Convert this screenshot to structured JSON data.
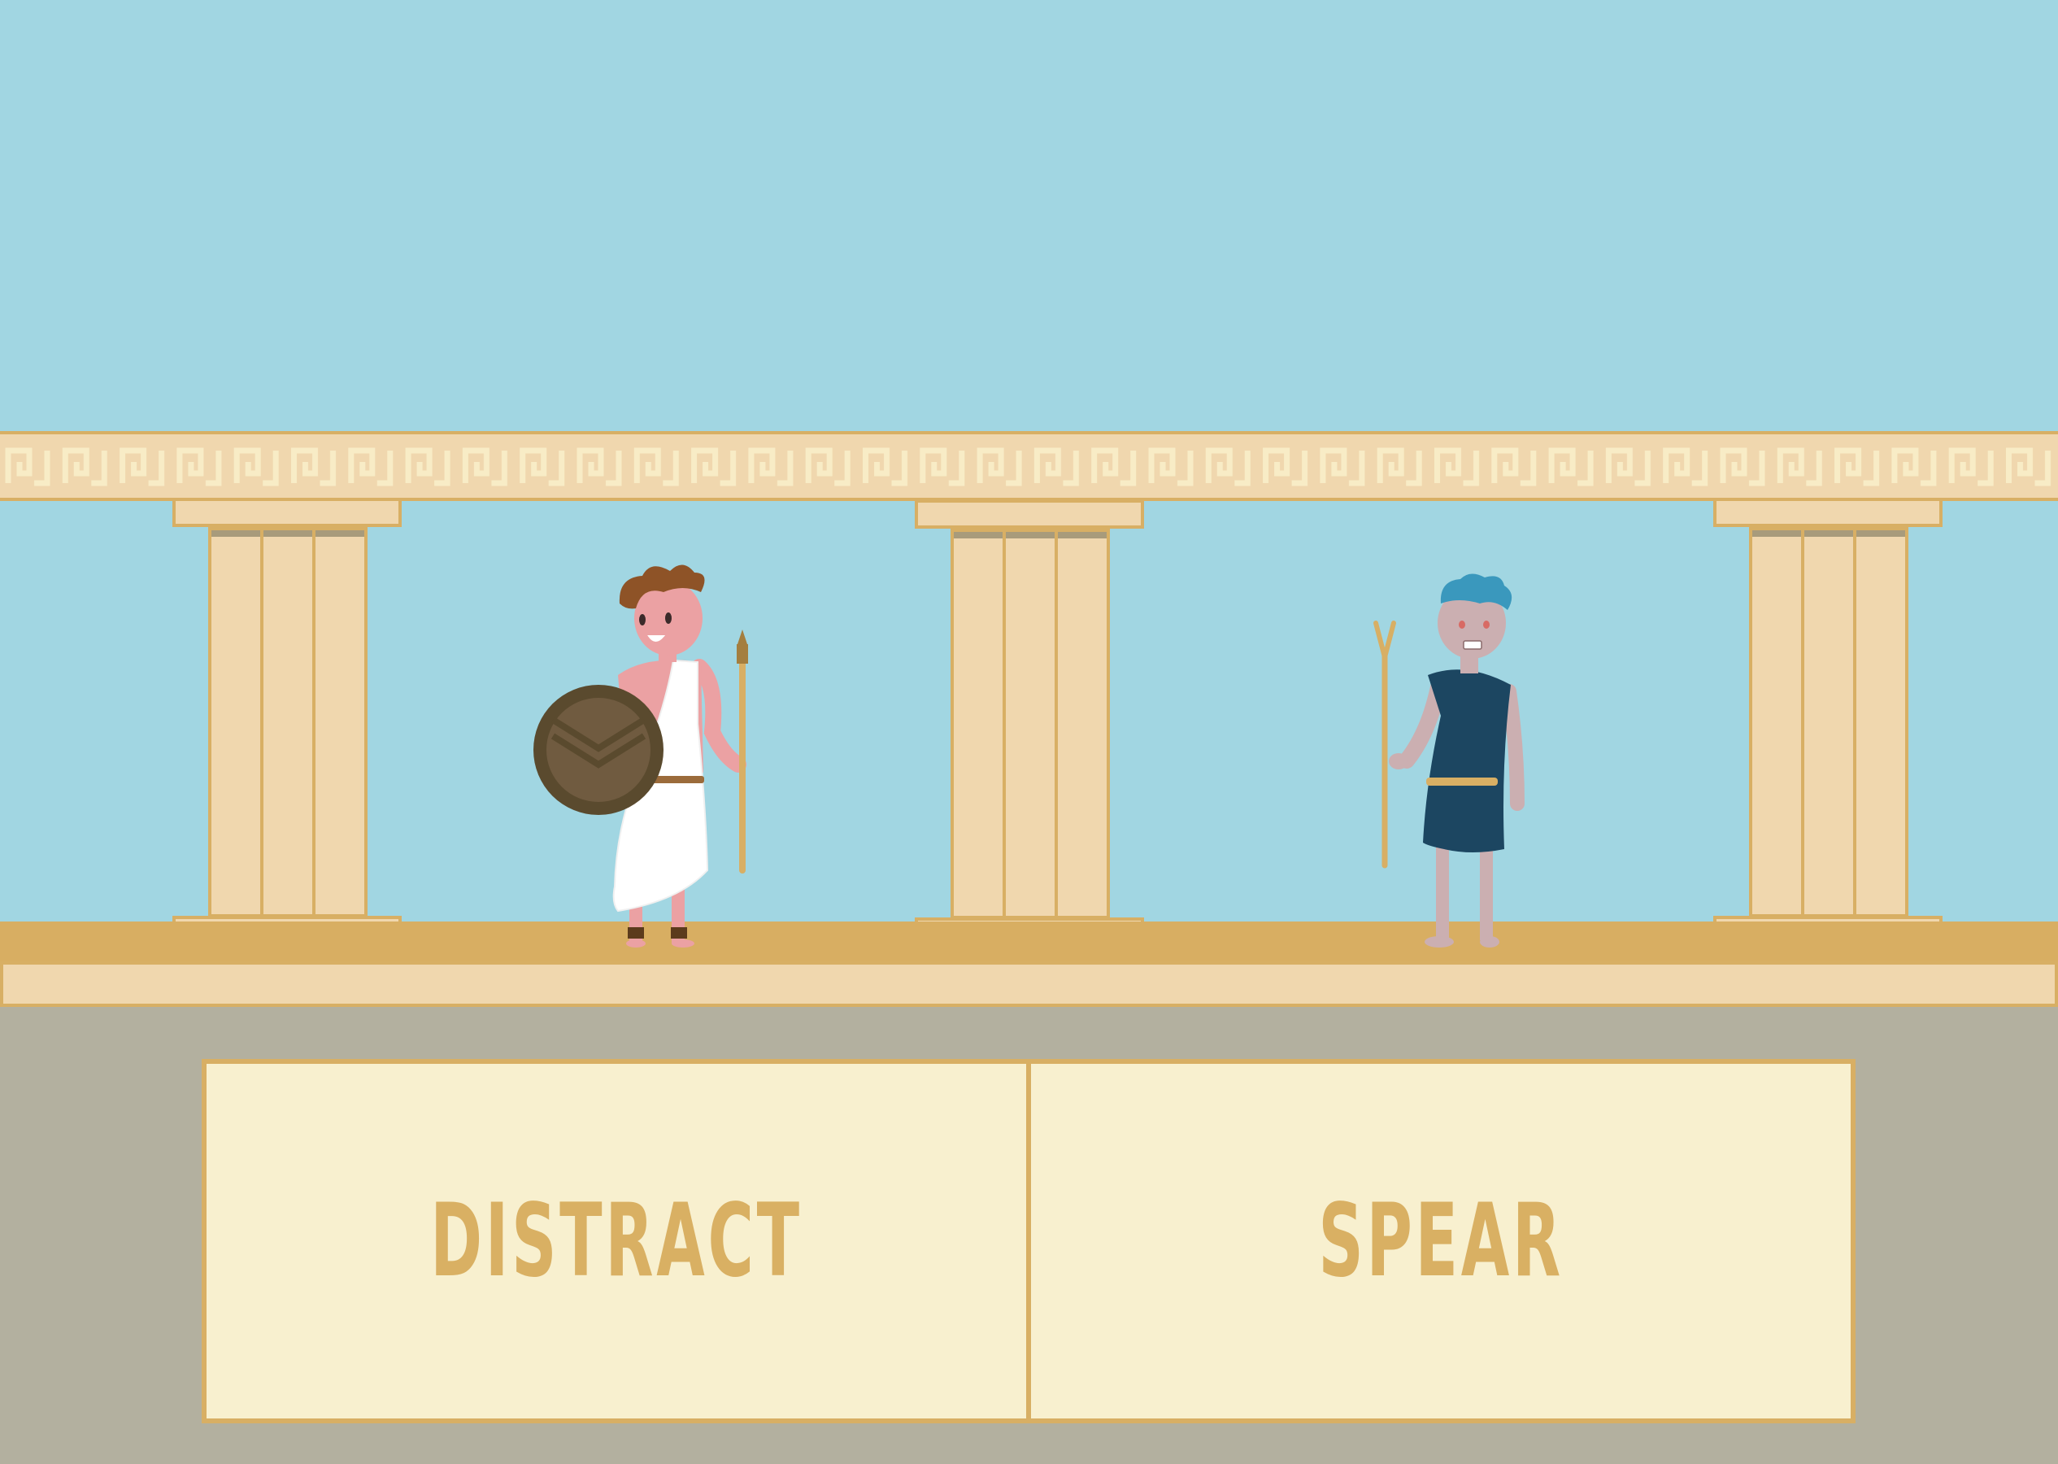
{
  "scene": {
    "colors": {
      "sky": "#a1d6e2",
      "stone": "#f0d7ae",
      "gold": "#d8af64",
      "ground": "#b3b09f",
      "panel": "#f8f0cf"
    }
  },
  "characters": {
    "hero": {
      "role": "hoplite",
      "items": [
        "shield-icon",
        "spear-icon"
      ]
    },
    "enemy": {
      "role": "opponent",
      "items": [
        "pitchfork-icon"
      ]
    }
  },
  "choices": [
    {
      "label": "DISTRACT"
    },
    {
      "label": "SPEAR"
    }
  ]
}
